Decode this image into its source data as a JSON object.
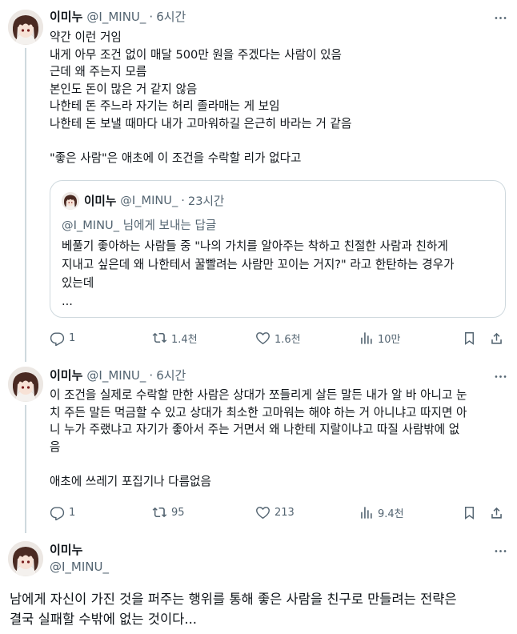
{
  "tweets": [
    {
      "name": "이미누",
      "handle": "@I_MINU_",
      "time": "6시간",
      "text": "약간 이런 거임\n내게 아무 조건 없이 매달 500만 원을 주겠다는 사람이 있음\n근데 왜 주는지 모름\n본인도 돈이 많은 거 같지 않음\n나한테 돈 주느라 자기는 허리 졸라매는 게 보임\n나한테 돈 보낼 때마다 내가 고마워하길 은근히 바라는 거 같음\n\n\"좋은 사람\"은 애초에 이 조건을 수락할 리가 없다고",
      "quote": {
        "name": "이미누",
        "handle": "@I_MINU_",
        "time": "23시간",
        "reply_mention": "@I_MINU_",
        "reply_suffix": " 님에게 보내는 답글",
        "text": "베풀기 좋아하는 사람들 중 \"나의 가치를 알아주는 착하고 친절한 사람과 친하게\n지내고 싶은데 왜 나한테서 꿀빨려는 사람만 꼬이는 거지?\" 라고 한탄하는 경우가\n있는데\n..."
      },
      "actions": {
        "replies": "1",
        "retweets": "1.4천",
        "likes": "1.6천",
        "views": "10만"
      }
    },
    {
      "name": "이미누",
      "handle": "@I_MINU_",
      "time": "6시간",
      "text": "이 조건을 실제로 수락할 만한 사람은 상대가 쪼들리게 살든 말든 내가 알 바 아니고 눈\n치 주든 말든 먹금할 수 있고 상대가 최소한 고마워는 해야 하는 거 아니냐고 따지면 아\n니 누가 주랬냐고 자기가 좋아서 주는 거면서 왜 나한테 지랄이냐고 따질 사람밖에 없\n음\n\n애초에 쓰레기 포집기나 다름없음",
      "actions": {
        "replies": "1",
        "retweets": "95",
        "likes": "213",
        "views": "9.4천"
      }
    },
    {
      "name": "이미누",
      "handle": "@I_MINU_",
      "text": "남에게 자신이 가진 것을 퍼주는 행위를 통해 좋은 사람을 친구로 만들려는 전략은\n결국 실패할 수밖에 없는 것이다..."
    }
  ],
  "icons": {
    "more": "more-horizontal-icon",
    "reply": "reply-icon",
    "retweet": "retweet-icon",
    "like": "heart-icon",
    "views": "views-chart-icon",
    "bookmark": "bookmark-icon",
    "share": "share-icon"
  },
  "colors": {
    "text": "#0f1419",
    "secondary": "#536471",
    "border": "#cfd9de"
  }
}
